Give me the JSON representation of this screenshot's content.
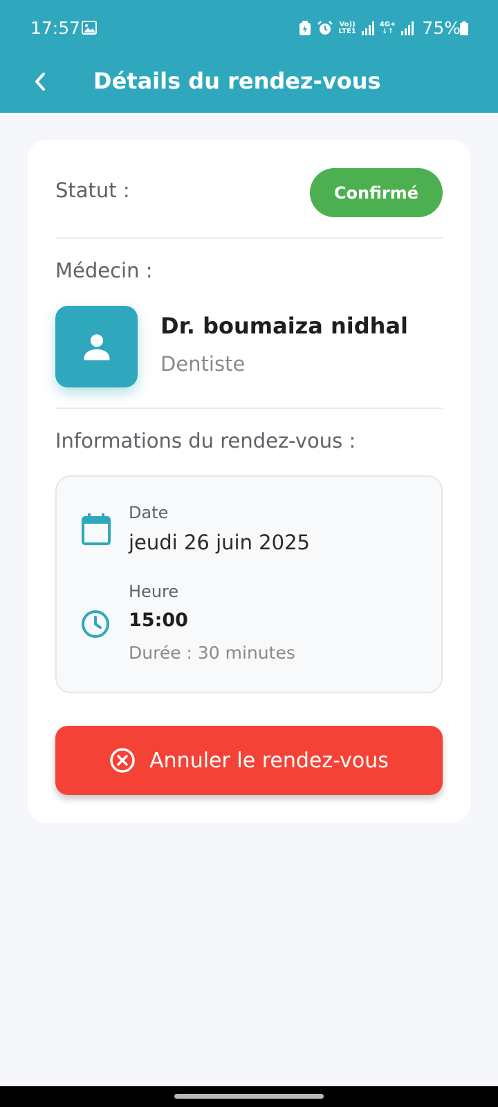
{
  "status_bar": {
    "time": "17:57",
    "volte_top": "Vo))",
    "volte_bottom": "LTE1",
    "net_top": "4G+",
    "battery": "75%"
  },
  "app_bar": {
    "title": "Détails du rendez-vous"
  },
  "details": {
    "status_label": "Statut :",
    "status_value": "Confirmé",
    "doctor_label": "Médecin :",
    "doctor_name": "Dr. boumaiza nidhal",
    "doctor_specialty": "Dentiste",
    "info_label": "Informations du rendez-vous :",
    "date_label": "Date",
    "date_value": "jeudi 26 juin 2025",
    "time_label": "Heure",
    "time_value": "15:00",
    "duration": "Durée : 30 minutes",
    "cancel_label": "Annuler le rendez-vous"
  },
  "colors": {
    "primary": "#2fa8bd",
    "confirmed": "#4cb050",
    "danger": "#f44336"
  }
}
